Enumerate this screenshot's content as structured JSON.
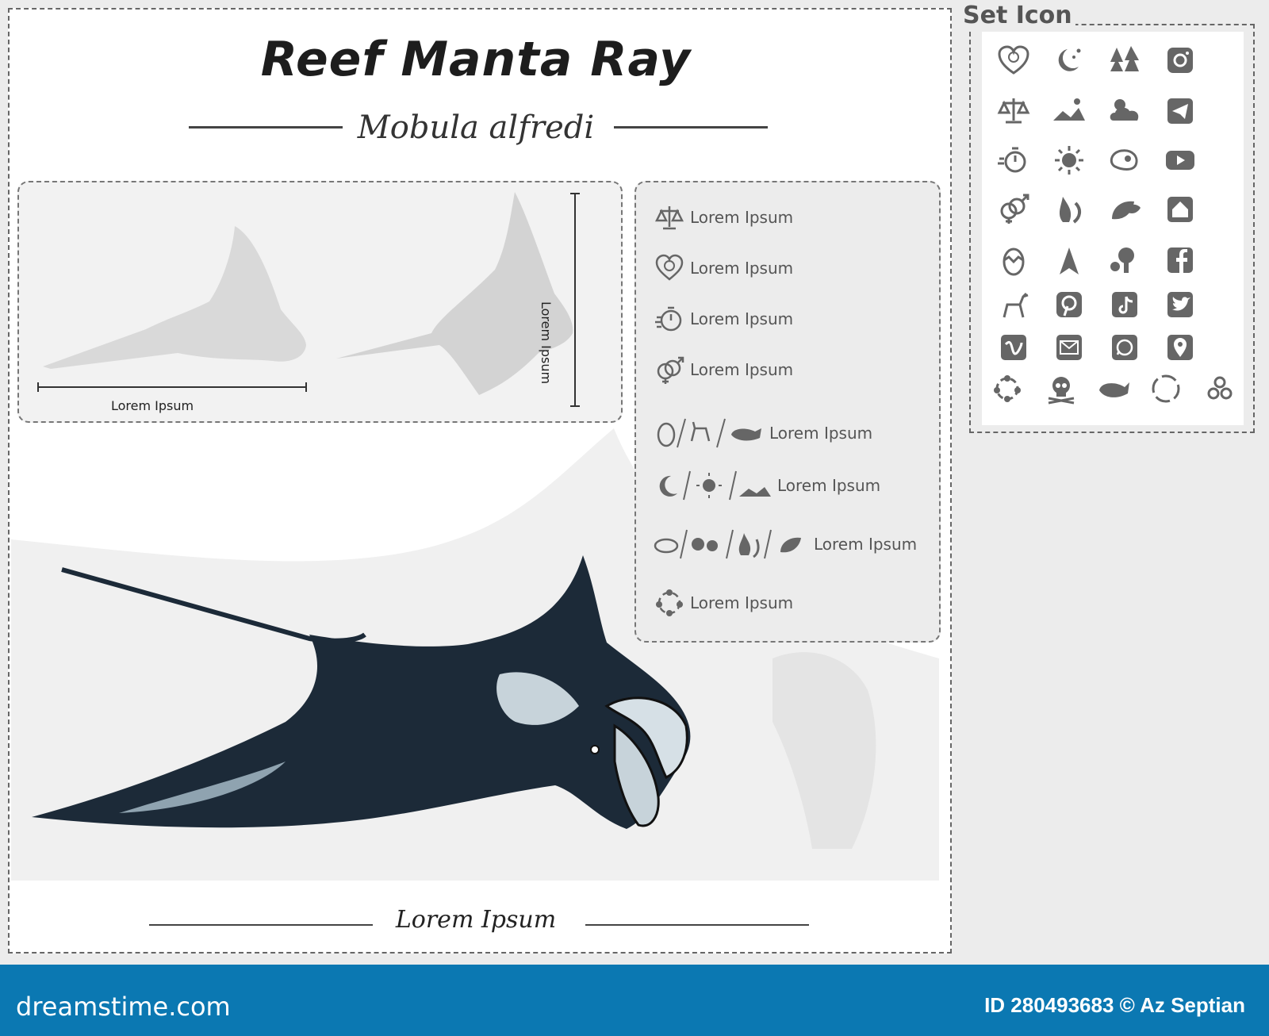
{
  "poster": {
    "title": "Reef Manta Ray",
    "subtitle": "Mobula alfredi",
    "size_width_label": "Lorem Ipsum",
    "size_height_label": "Lorem Ipsum",
    "caption": "Lorem Ipsum"
  },
  "info": {
    "rows": [
      {
        "icon": "scale-icon",
        "label": "Lorem Ipsum"
      },
      {
        "icon": "heart-clock-icon",
        "label": "Lorem Ipsum"
      },
      {
        "icon": "stopwatch-icon",
        "label": "Lorem Ipsum"
      },
      {
        "icon": "gender-icon",
        "label": "Lorem Ipsum"
      },
      {
        "icon": "egg-deer-whale-icons",
        "label": "Lorem Ipsum"
      },
      {
        "icon": "moon-sun-landscape-icons",
        "label": "Lorem Ipsum"
      },
      {
        "icon": "diet-icons",
        "label": "Lorem Ipsum"
      },
      {
        "icon": "life-cycle-icon",
        "label": "Lorem Ipsum"
      }
    ]
  },
  "icon_set": {
    "title": "Set Icon",
    "icons": [
      "heart-clock-icon",
      "moon-stars-icon",
      "forest-icon",
      "instagram-icon",
      "scale-icon",
      "landscape-icon",
      "cloud-sun-icon",
      "telegram-icon",
      "stopwatch-icon",
      "sun-icon",
      "meat-icon",
      "youtube-icon",
      "gender-icon",
      "fire-shrimp-icon",
      "leaves-icon",
      "home-icon",
      "hatching-egg-icon",
      "north-arrow-icon",
      "fruit-tree-icon",
      "facebook-icon",
      "deer-icon",
      "pinterest-icon",
      "tiktok-icon",
      "twitter-icon",
      "vimeo-icon",
      "mail-icon",
      "whatsapp-icon",
      "location-icon",
      "cycle-icon",
      "skull-icon",
      "whale-icon",
      "recycle-icon",
      "molecule-icon"
    ]
  },
  "footer": {
    "brand": "dreamstime.com",
    "id_text": "ID 280493683 © Az Septian"
  },
  "colors": {
    "accent_blue": "#0b78b2",
    "ray_dark": "#1c2a38",
    "ray_light": "#c7d3da",
    "silhouette": "#dcdcdc",
    "icon_gray": "#666666"
  }
}
